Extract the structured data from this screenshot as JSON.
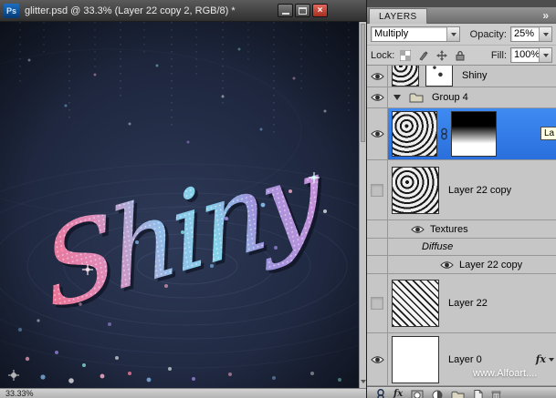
{
  "window": {
    "ps_badge": "Ps",
    "title": "glitter.psd @ 33.3% (Layer 22 copy 2, RGB/8) *",
    "close_glyph": "×",
    "status_zoom": "33.33%",
    "canvas_word": "Shiny"
  },
  "panel": {
    "tab_label": "LAYERS",
    "collapse_glyph": "»",
    "blend_mode": "Multiply",
    "opacity_label": "Opacity:",
    "opacity_value": "25%",
    "lock_label": "Lock:",
    "fill_label": "Fill:",
    "fill_value": "100%",
    "tooltip_text": "La",
    "watermark": "www.Alfoart....",
    "fx_badge": "fx",
    "footer_fx": "fx",
    "rows": [
      {
        "label": "Shiny"
      },
      {
        "label": "Group 4"
      },
      {
        "label": ""
      },
      {
        "label": "Layer 22 copy"
      },
      {
        "label": "Textures"
      },
      {
        "label": "Diffuse"
      },
      {
        "label": "Layer 22 copy"
      },
      {
        "label": "Layer 22"
      },
      {
        "label": "Layer 0"
      }
    ]
  },
  "colors": {
    "selection_blue": "#2e7bea",
    "panel_gray": "#c6c6c6",
    "canvas_navy": "#1f2840",
    "accent_pink": "#ea7192",
    "accent_cyan": "#83d4ea"
  }
}
